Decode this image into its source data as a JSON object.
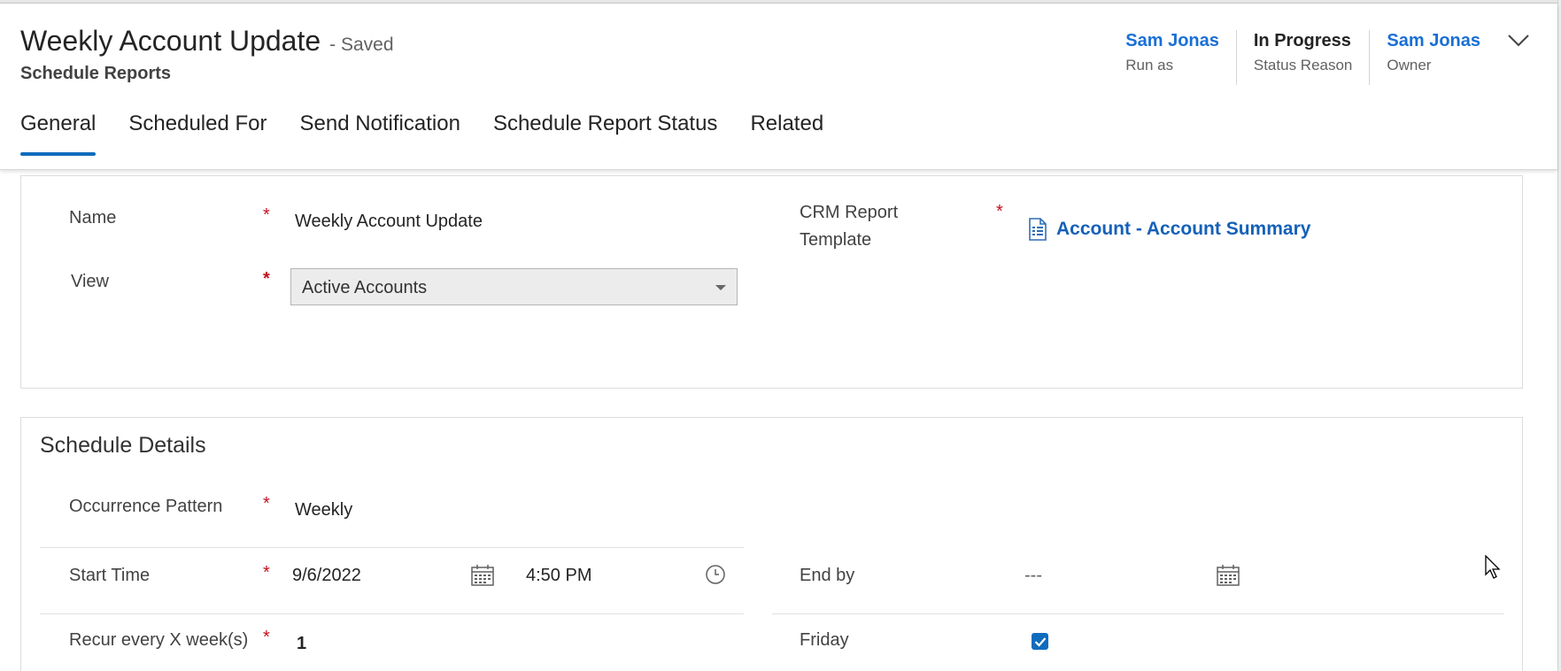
{
  "header": {
    "title": "Weekly Account Update",
    "saved": "- Saved",
    "entity": "Schedule Reports",
    "fields": [
      {
        "value": "Sam Jonas",
        "label": "Run as"
      },
      {
        "value": "In Progress",
        "label": "Status Reason"
      },
      {
        "value": "Sam Jonas",
        "label": "Owner"
      }
    ]
  },
  "tabs": [
    "General",
    "Scheduled For",
    "Send Notification",
    "Schedule Report Status",
    "Related"
  ],
  "general": {
    "name_label": "Name",
    "name_value": "Weekly Account Update",
    "view_label": "View",
    "view_value": "Active Accounts",
    "crm_label_1": "CRM Report",
    "crm_label_2": "Template",
    "crm_value": "Account - Account Summary"
  },
  "schedule": {
    "title": "Schedule Details",
    "occurrence_label": "Occurrence Pattern",
    "occurrence_value": "Weekly",
    "start_label": "Start Time",
    "start_date": "9/6/2022",
    "start_time": "4:50 PM",
    "end_label": "End by",
    "end_value": "---",
    "recur_label": "Recur every X week(s)",
    "recur_value": "1",
    "friday_label": "Friday",
    "friday_checked": true
  },
  "required_mark": "*",
  "colors": {
    "accent": "#0f6cbd",
    "link": "#1561b8",
    "required": "#c50f1f"
  }
}
